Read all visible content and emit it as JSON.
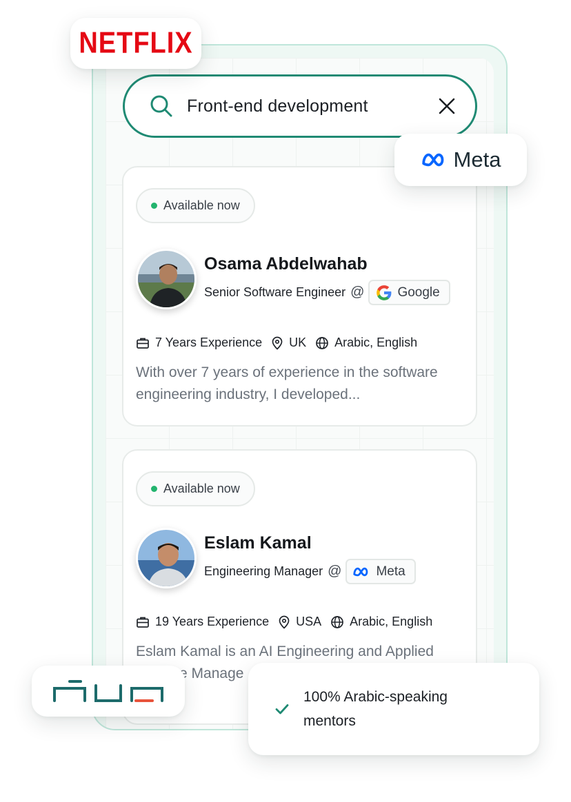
{
  "brands": {
    "netflix": "NETFLIX",
    "meta": "Meta"
  },
  "colors": {
    "accent": "#1f8a73",
    "available": "#22b46e",
    "netflix": "#e50914",
    "meta_blue": "#0866ff"
  },
  "search": {
    "value": "Front-end development",
    "icon": "search-icon",
    "clear_icon": "close-icon"
  },
  "mentors": [
    {
      "status": "Available now",
      "name": "Osama Abdelwahab",
      "role": "Senior Software Engineer",
      "at": "@",
      "company": "Google",
      "experience": "7 Years Experience",
      "location": "UK",
      "languages": "Arabic, English",
      "bio": "With over 7 years of experience in the software engineering industry, I developed..."
    },
    {
      "status": "Available now",
      "name": "Eslam Kamal",
      "role": "Engineering Manager",
      "at": "@",
      "company": "Meta",
      "experience": "19 Years Experience",
      "location": "USA",
      "languages": "Arabic, English",
      "bio": "Eslam Kamal is an AI Engineering and Applied Science Manage"
    }
  ],
  "benefit": {
    "text": "100% Arabic-speaking mentors",
    "icon": "check-icon"
  }
}
